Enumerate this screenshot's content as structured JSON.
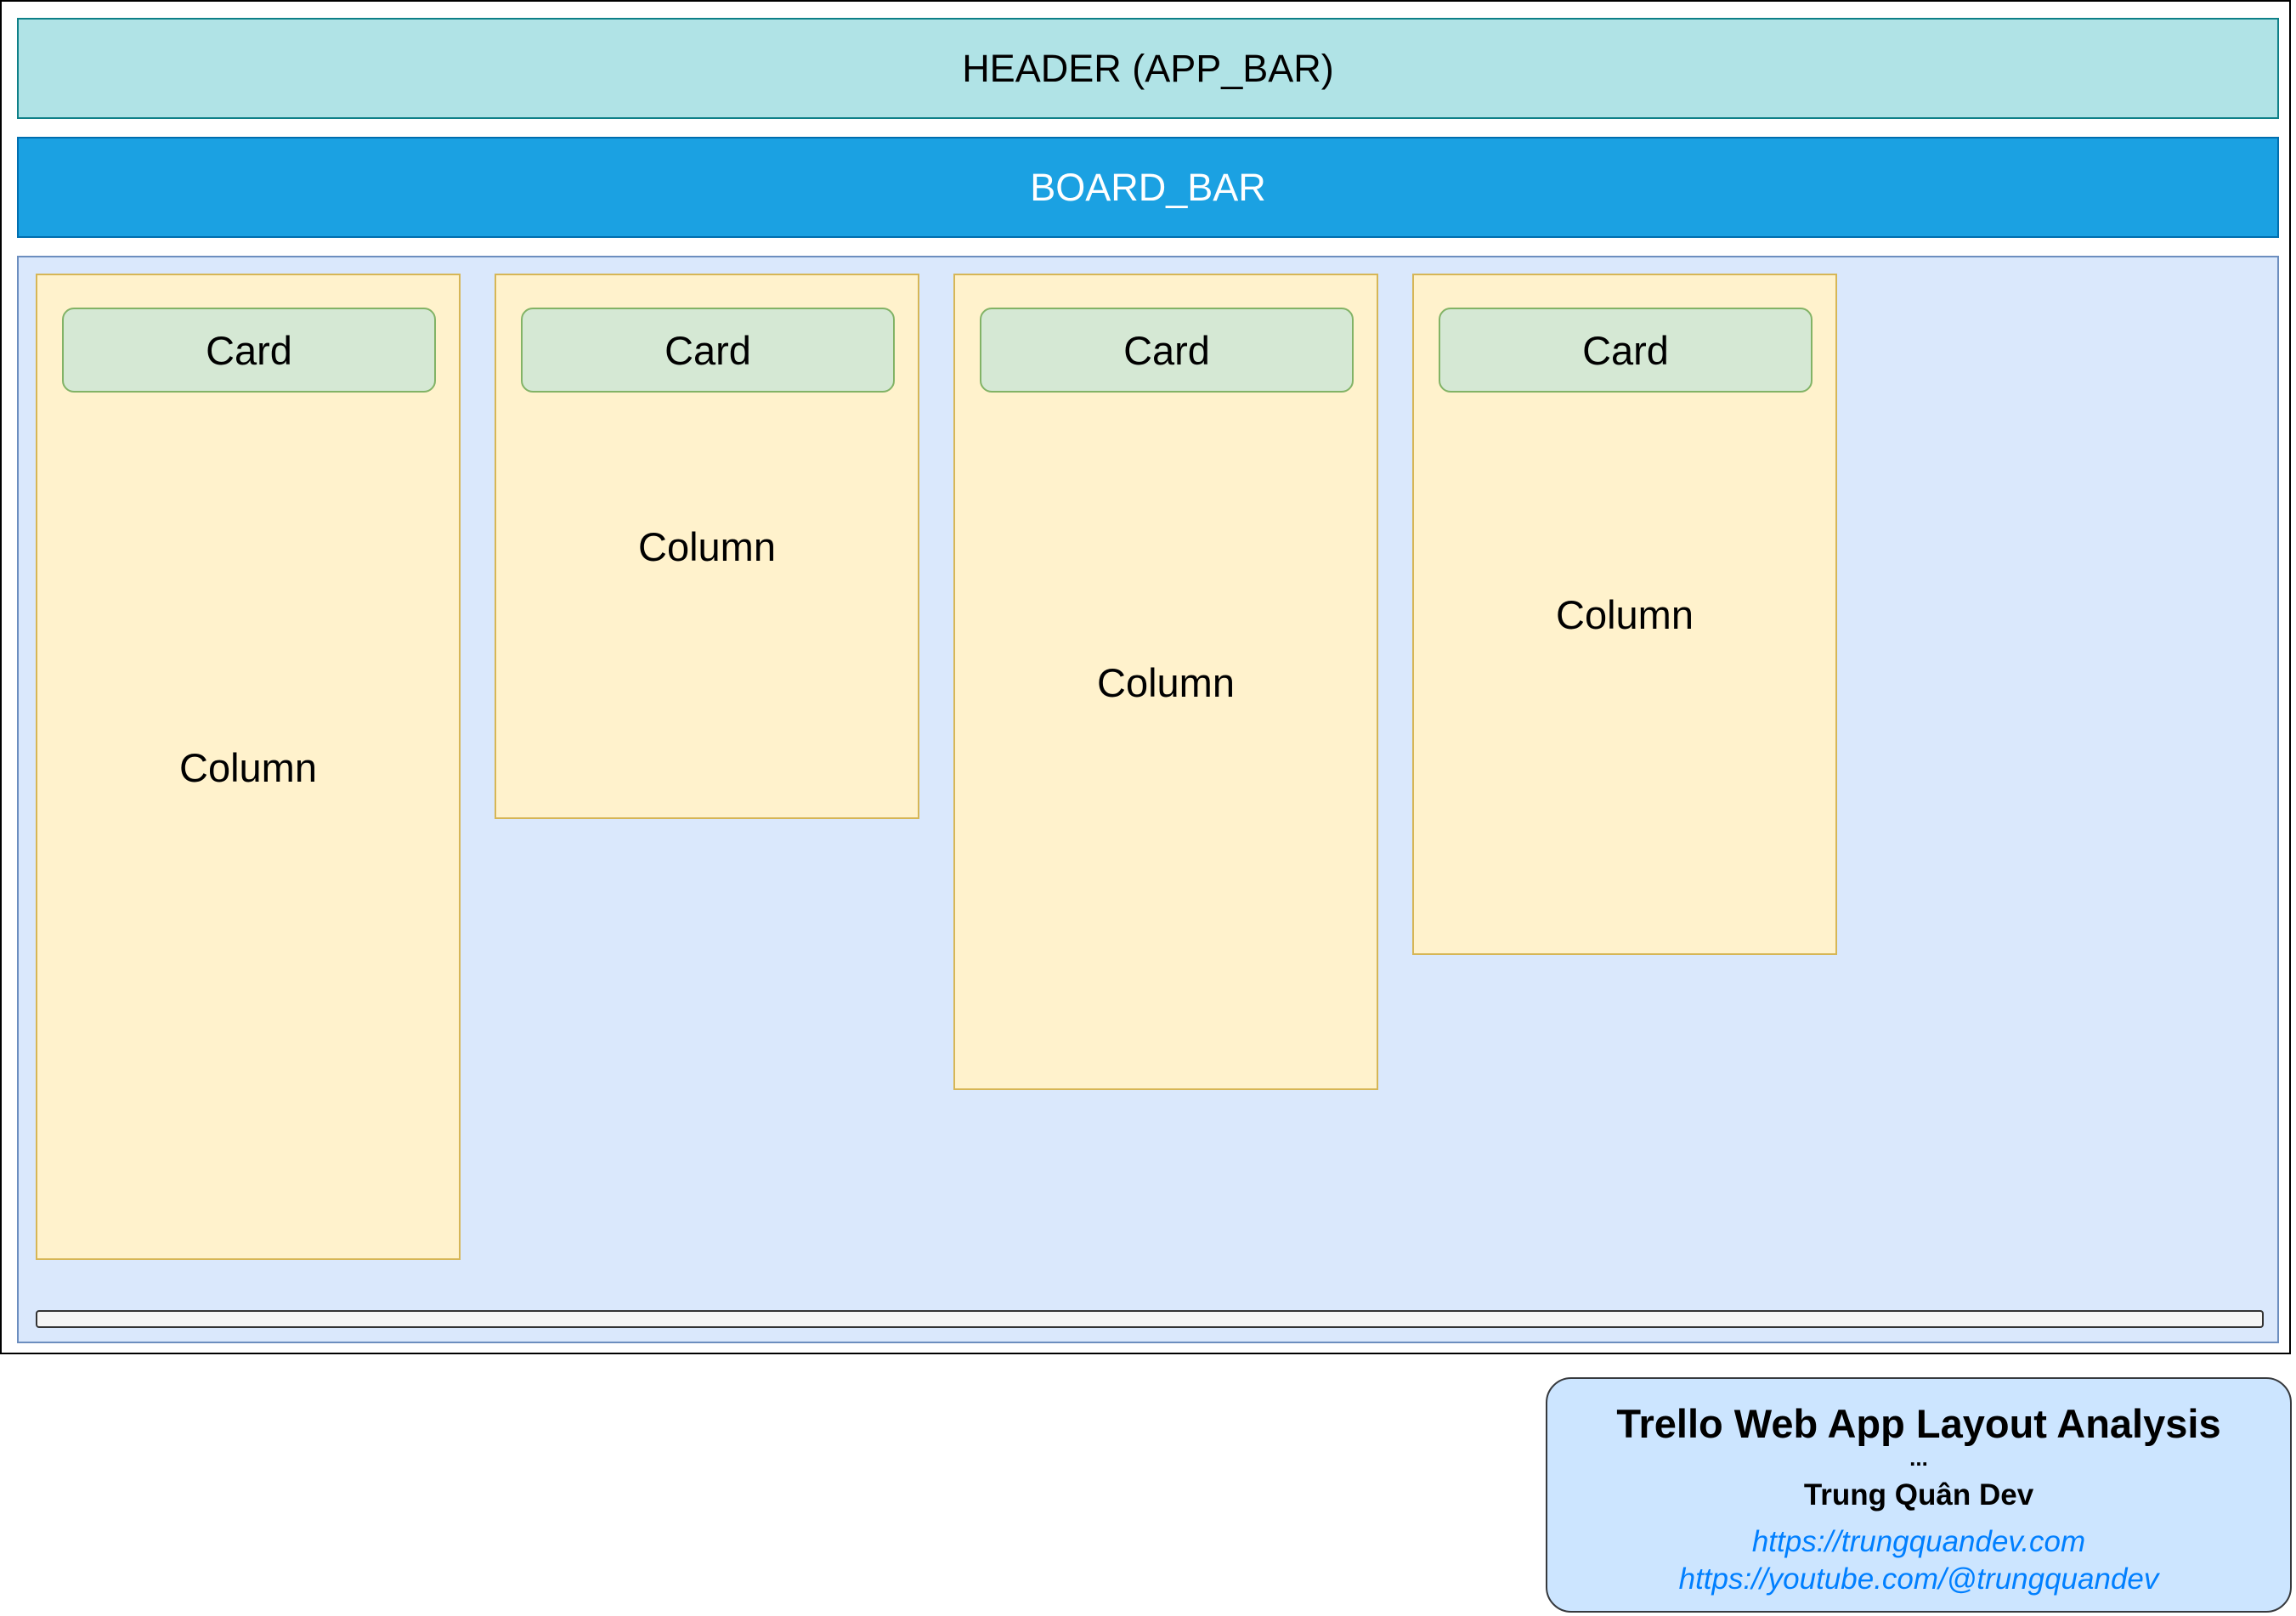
{
  "header": {
    "label": "HEADER (APP_BAR)"
  },
  "board_bar": {
    "label": "BOARD_BAR"
  },
  "board": {
    "columns": [
      {
        "label": "Column",
        "card": {
          "label": "Card"
        }
      },
      {
        "label": "Column",
        "card": {
          "label": "Card"
        }
      },
      {
        "label": "Column",
        "card": {
          "label": "Card"
        }
      },
      {
        "label": "Column",
        "card": {
          "label": "Card"
        }
      }
    ]
  },
  "info": {
    "title": "Trello Web App Layout Analysis",
    "separator": "...",
    "author": "Trung Quân Dev",
    "links": [
      "https://trungquandev.com",
      "https://youtube.com/@trungquandev"
    ]
  },
  "colors": {
    "header_fill": "#b0e3e6",
    "header_stroke": "#0e8088",
    "board_bar_fill": "#1ba1e2",
    "board_bar_stroke": "#006eaf",
    "board_fill": "#dae8fc",
    "board_stroke": "#6c8ebf",
    "column_fill": "#fff2cc",
    "column_stroke": "#d6b656",
    "card_fill": "#d5e8d4",
    "card_stroke": "#82b366",
    "info_fill": "#cce5ff",
    "link_color": "#007fff"
  }
}
